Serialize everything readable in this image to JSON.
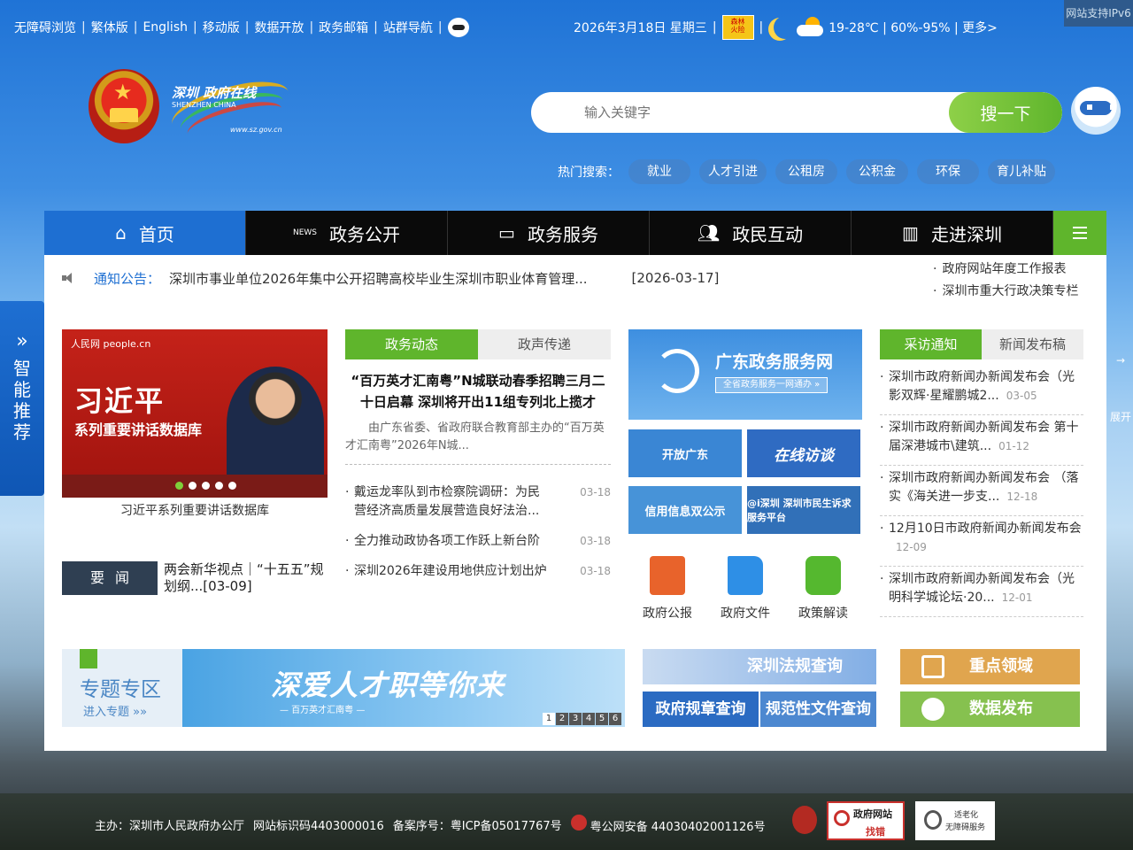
{
  "topbar": {
    "links": [
      "无障碍浏览",
      "繁体版",
      "English",
      "移动版",
      "数据开放",
      "政务邮箱",
      "站群导航"
    ]
  },
  "weather": {
    "date": "2026年3月18日 星期三",
    "temp": "19-28℃ | 60%-95% | 更多>"
  },
  "ipv6": "网站支持IPv6",
  "logo": {
    "cn": "深圳 政府在线",
    "en": "SHENZHEN  CHINA",
    "url": "www.sz.gov.cn"
  },
  "search": {
    "placeholder": "输入关键字",
    "button": "搜一下"
  },
  "hot": {
    "label": "热门搜索：",
    "items": [
      "就业",
      "人才引进",
      "公租房",
      "公积金",
      "环保",
      "育儿补贴"
    ]
  },
  "nav": [
    "首页",
    "政务公开",
    "政务服务",
    "政民互动",
    "走进深圳"
  ],
  "notice": {
    "label": "通知公告：",
    "text": "深圳市事业单位2026年集中公开招聘高校毕业生深圳市职业体育管理...",
    "date": "[2026-03-17]"
  },
  "side_links": [
    "政府网站年度工作报表",
    "深圳市重大行政决策专栏"
  ],
  "carousel": {
    "brand": "人民网 people.cn",
    "title": "习近平",
    "subtitle": "系列重要讲话数据库",
    "caption": "习近平系列重要讲话数据库"
  },
  "yaowen": {
    "label": "要闻",
    "text": "两会新华视点｜“十五五”规划纲...[03-09]"
  },
  "mid_tabs": [
    "政务动态",
    "政声传递"
  ],
  "headline": "“百万英才汇南粤”N城联动春季招聘三月二十日启幕 深圳将开出11组专列北上揽才",
  "summary": "由广东省委、省政府联合教育部主办的“百万英才汇南粤”2026年N城...",
  "mid_news": [
    {
      "title": "戴运龙率队到市检察院调研：为民营经济高质量发展营造良好法治...",
      "date": "03-18"
    },
    {
      "title": "全力推动政协各项工作跃上新台阶",
      "date": "03-18"
    },
    {
      "title": "深圳2026年建设用地供应计划出炉",
      "date": "03-18"
    }
  ],
  "services": {
    "gd_title": "广东政务服务网",
    "gd_btn": "全省政务服务一网通办 »",
    "open": "开放广东",
    "online": "在线访谈",
    "credit": "信用信息双公示",
    "people": "@i深圳 深圳市民生诉求服务平台"
  },
  "docs": [
    "政府公报",
    "政府文件",
    "政策解读"
  ],
  "right_tabs": [
    "采访通知",
    "新闻发布稿"
  ],
  "right_news": [
    {
      "title": "深圳市政府新闻办新闻发布会（光影双辉·星耀鹏城2...",
      "date": "03-05"
    },
    {
      "title": "深圳市政府新闻办新闻发布会 第十届深港城市\\建筑...",
      "date": "01-12"
    },
    {
      "title": "深圳市政府新闻办新闻发布会 （落实《海关进一步支...",
      "date": "12-18"
    },
    {
      "title": "12月10日市政府新闻办新闻发布会",
      "date": "12-09"
    },
    {
      "title": "深圳市政府新闻办新闻发布会（光明科学城论坛·20...",
      "date": "12-01"
    }
  ],
  "bottom": {
    "ztzq": "专题专区",
    "ztzq_sub": "进入专题 »»",
    "talent": "深爱人才职等你来",
    "talent_sub": "— 百万英才汇南粤 —",
    "pages": [
      "1",
      "2",
      "3",
      "4",
      "5",
      "6"
    ],
    "law": "深圳法规查询",
    "gz": "政府规章查询",
    "gf": "规范性文件查询",
    "zd": "重点领域",
    "sj": "数据发布"
  },
  "smart": {
    "label": "智能推荐",
    "expand": "展开"
  },
  "footer": {
    "host": "主办：深圳市人民政府办公厅",
    "code": "网站标识码4403000016",
    "icp": "备案序号：粤ICP备05017767号",
    "police": "粤公网安备 44030402001126号",
    "find_a": "政府网站",
    "find_b": "找错",
    "age_a": "适老化",
    "age_b": "无障碍服务"
  },
  "colors": {
    "primary": "#1e6fd2",
    "accent": "#5fb52c",
    "nav_bg": "#0a0a0a"
  }
}
